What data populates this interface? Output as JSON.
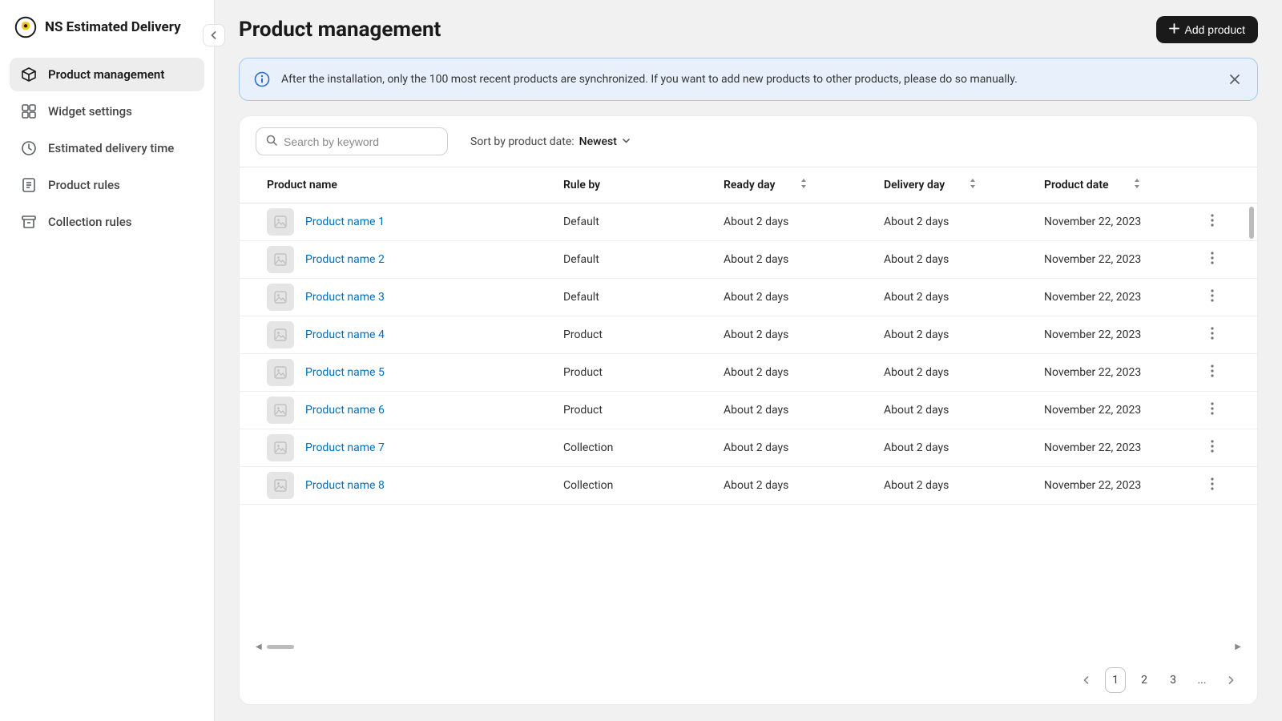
{
  "app": {
    "title": "NS Estimated Delivery"
  },
  "sidebar": {
    "items": [
      {
        "label": "Product management"
      },
      {
        "label": "Widget settings"
      },
      {
        "label": "Estimated delivery time"
      },
      {
        "label": "Product rules"
      },
      {
        "label": "Collection rules"
      }
    ]
  },
  "header": {
    "page_title": "Product management",
    "add_button": "Add product"
  },
  "banner": {
    "text": "After the installation, only the 100 most recent products are synchronized. If you want to add new products to other products, please do so manually."
  },
  "toolbar": {
    "search_placeholder": "Search by keyword",
    "sort_label": "Sort by product date:",
    "sort_value": "Newest"
  },
  "table": {
    "columns": {
      "name": "Product name",
      "rule": "Rule by",
      "ready": "Ready day",
      "delivery": "Delivery day",
      "date": "Product date"
    },
    "rows": [
      {
        "name": "Product name 1",
        "rule": "Default",
        "ready": "About 2 days",
        "delivery": "About 2 days",
        "date": "November 22, 2023"
      },
      {
        "name": "Product name 2",
        "rule": "Default",
        "ready": "About 2 days",
        "delivery": "About 2 days",
        "date": "November 22, 2023"
      },
      {
        "name": "Product name 3",
        "rule": "Default",
        "ready": "About 2 days",
        "delivery": "About 2 days",
        "date": "November 22, 2023"
      },
      {
        "name": "Product name 4",
        "rule": "Product",
        "ready": "About 2 days",
        "delivery": "About 2 days",
        "date": "November 22, 2023"
      },
      {
        "name": "Product name 5",
        "rule": "Product",
        "ready": "About 2 days",
        "delivery": "About 2 days",
        "date": "November 22, 2023"
      },
      {
        "name": "Product name 6",
        "rule": "Product",
        "ready": "About 2 days",
        "delivery": "About 2 days",
        "date": "November 22, 2023"
      },
      {
        "name": "Product name 7",
        "rule": "Collection",
        "ready": "About 2 days",
        "delivery": "About 2 days",
        "date": "November 22, 2023"
      },
      {
        "name": "Product name 8",
        "rule": "Collection",
        "ready": "About 2 days",
        "delivery": "About 2 days",
        "date": "November 22, 2023"
      }
    ]
  },
  "pagination": {
    "pages": [
      "1",
      "2",
      "3",
      "..."
    ]
  }
}
